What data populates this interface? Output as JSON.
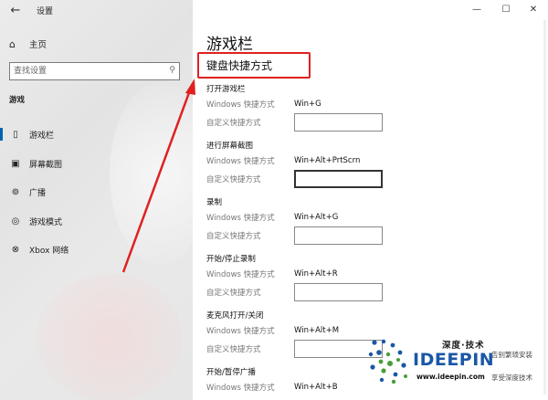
{
  "window": {
    "title": "设置",
    "back_glyph": "←",
    "minimize_glyph": "—",
    "maximize_glyph": "☐",
    "close_glyph": "✕"
  },
  "sidebar": {
    "home_label": "主页",
    "search_placeholder": "查找设置",
    "section_label": "游戏",
    "items": [
      {
        "label": "游戏栏",
        "icon": "game-bar-icon",
        "glyph": "▯",
        "selected": true
      },
      {
        "label": "屏幕截图",
        "icon": "screenshot-icon",
        "glyph": "▣",
        "selected": false
      },
      {
        "label": "广播",
        "icon": "broadcast-icon",
        "glyph": "⊚",
        "selected": false
      },
      {
        "label": "游戏模式",
        "icon": "game-mode-icon",
        "glyph": "◎",
        "selected": false
      },
      {
        "label": "Xbox 网络",
        "icon": "xbox-icon",
        "glyph": "⊗",
        "selected": false
      }
    ]
  },
  "main": {
    "page_title": "游戏栏",
    "subtitle": "键盘快捷方式",
    "windows_shortcut_label": "Windows 快捷方式",
    "custom_shortcut_label": "自定义快捷方式",
    "shortcuts": [
      {
        "title": "打开游戏栏",
        "windows": "Win+G"
      },
      {
        "title": "进行屏幕截图",
        "windows": "Win+Alt+PrtScrn"
      },
      {
        "title": "录制",
        "windows": "Win+Alt+G"
      },
      {
        "title": "开始/停止录制",
        "windows": "Win+Alt+R"
      },
      {
        "title": "麦克风打开/关闭",
        "windows": "Win+Alt+M"
      },
      {
        "title": "开始/暂停广播",
        "windows": "Win+Alt+B"
      }
    ]
  },
  "watermark": {
    "cn_title": "深度·技术",
    "brand": "IDEEPIN",
    "site": "www.ideepin.com",
    "right_top": "告别繁琐安装",
    "right_bottom": "享受深度技术"
  },
  "colors": {
    "accent": "#0063b1",
    "highlight": "#e02020",
    "brand_blue": "#1b57a6",
    "brand_green": "#4a9d3a"
  }
}
